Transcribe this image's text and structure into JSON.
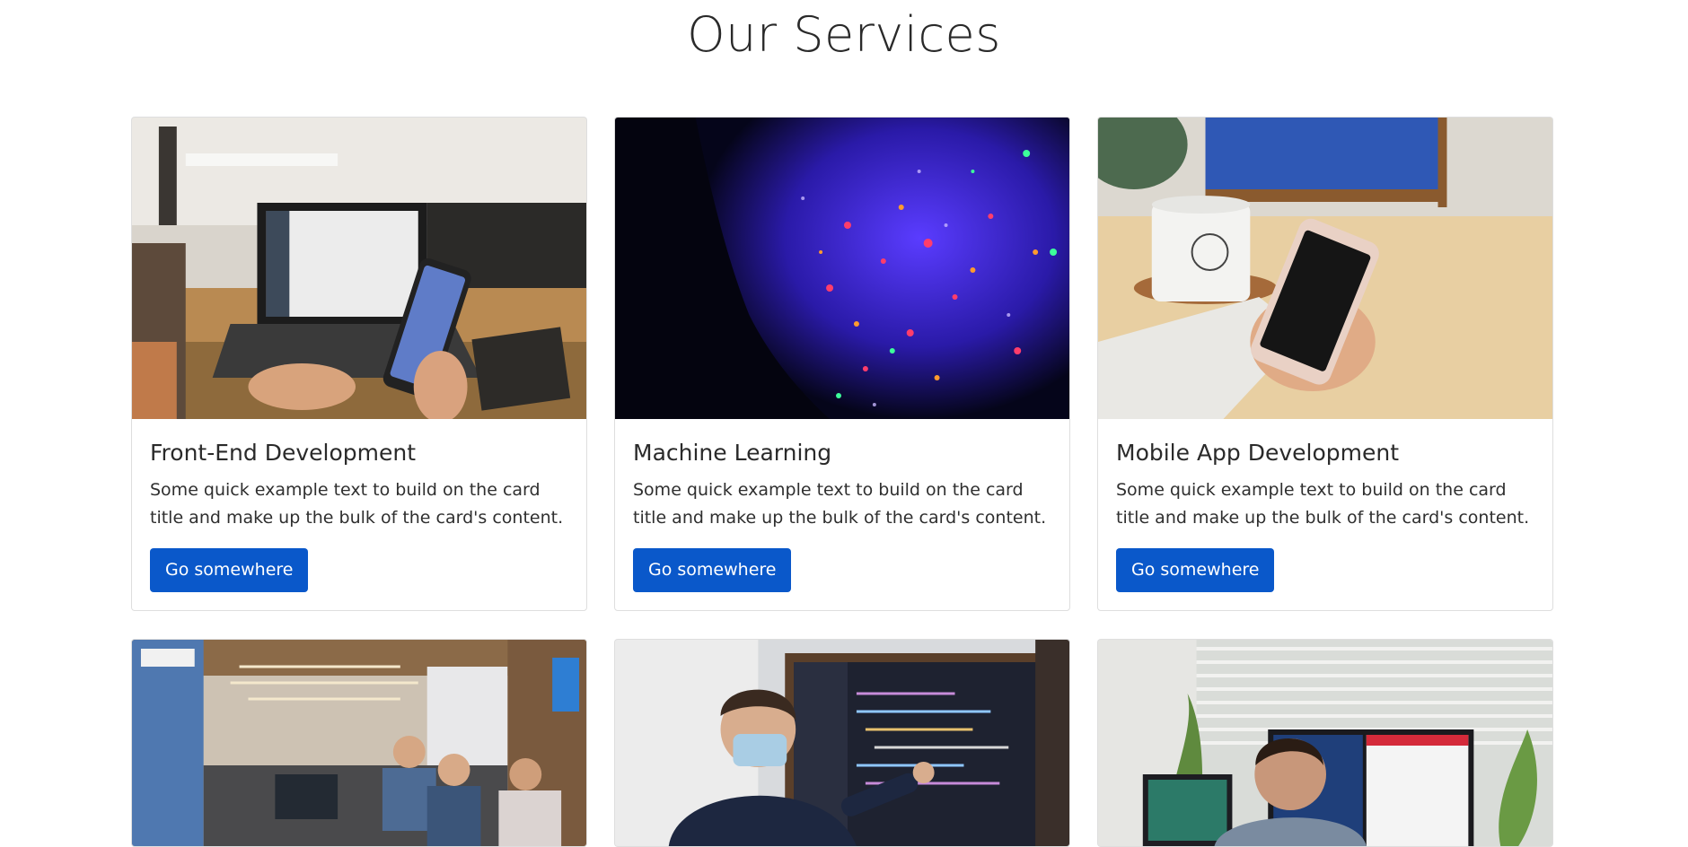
{
  "page": {
    "title": "Our Services"
  },
  "cards": [
    {
      "title": "Front-End Development",
      "text": "Some quick example text to build on the card title and make up the bulk of the card's content.",
      "button": "Go somewhere",
      "image": "laptop-phone-photo"
    },
    {
      "title": "Machine Learning",
      "text": "Some quick example text to build on the card title and make up the bulk of the card's content.",
      "button": "Go somewhere",
      "image": "neon-face-photo"
    },
    {
      "title": "Mobile App Development",
      "text": "Some quick example text to build on the card title and make up the bulk of the card's content.",
      "button": "Go somewhere",
      "image": "hand-phone-photo"
    },
    {
      "image": "open-office-team-photo"
    },
    {
      "image": "developer-screen-presentation-photo"
    },
    {
      "image": "developer-monitors-photo"
    }
  ],
  "colors": {
    "button": "#0a58ca",
    "title": "#2a2a2a"
  }
}
